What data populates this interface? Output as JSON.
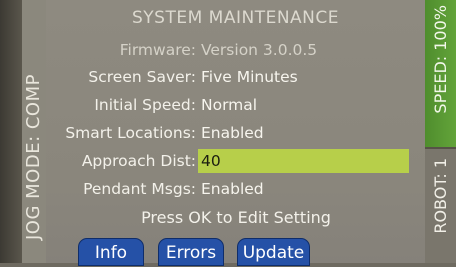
{
  "screen": {
    "title": "SYSTEM MAINTENANCE",
    "jog_mode_label": "JOG MODE: COMP",
    "speed_label": "SPEED: 100%",
    "robot_label": "ROBOT: 1",
    "hint": "Press OK to Edit Setting"
  },
  "settings": [
    {
      "label": "Firmware:",
      "value": "Version 3.0.0.5"
    },
    {
      "label": "Screen Saver:",
      "value": "Five Minutes"
    },
    {
      "label": "Initial Speed:",
      "value": "Normal"
    },
    {
      "label": "Smart Locations:",
      "value": "Enabled"
    },
    {
      "label": "Approach Dist:",
      "value": "40"
    },
    {
      "label": "Pendant Msgs:",
      "value": "Enabled"
    }
  ],
  "buttons": {
    "info": "Info",
    "errors": "Errors",
    "update": "Update"
  },
  "colors": {
    "selected_row": "#b7cf4a",
    "speed_bar": "#5a9a34",
    "button": "#2551a7"
  }
}
